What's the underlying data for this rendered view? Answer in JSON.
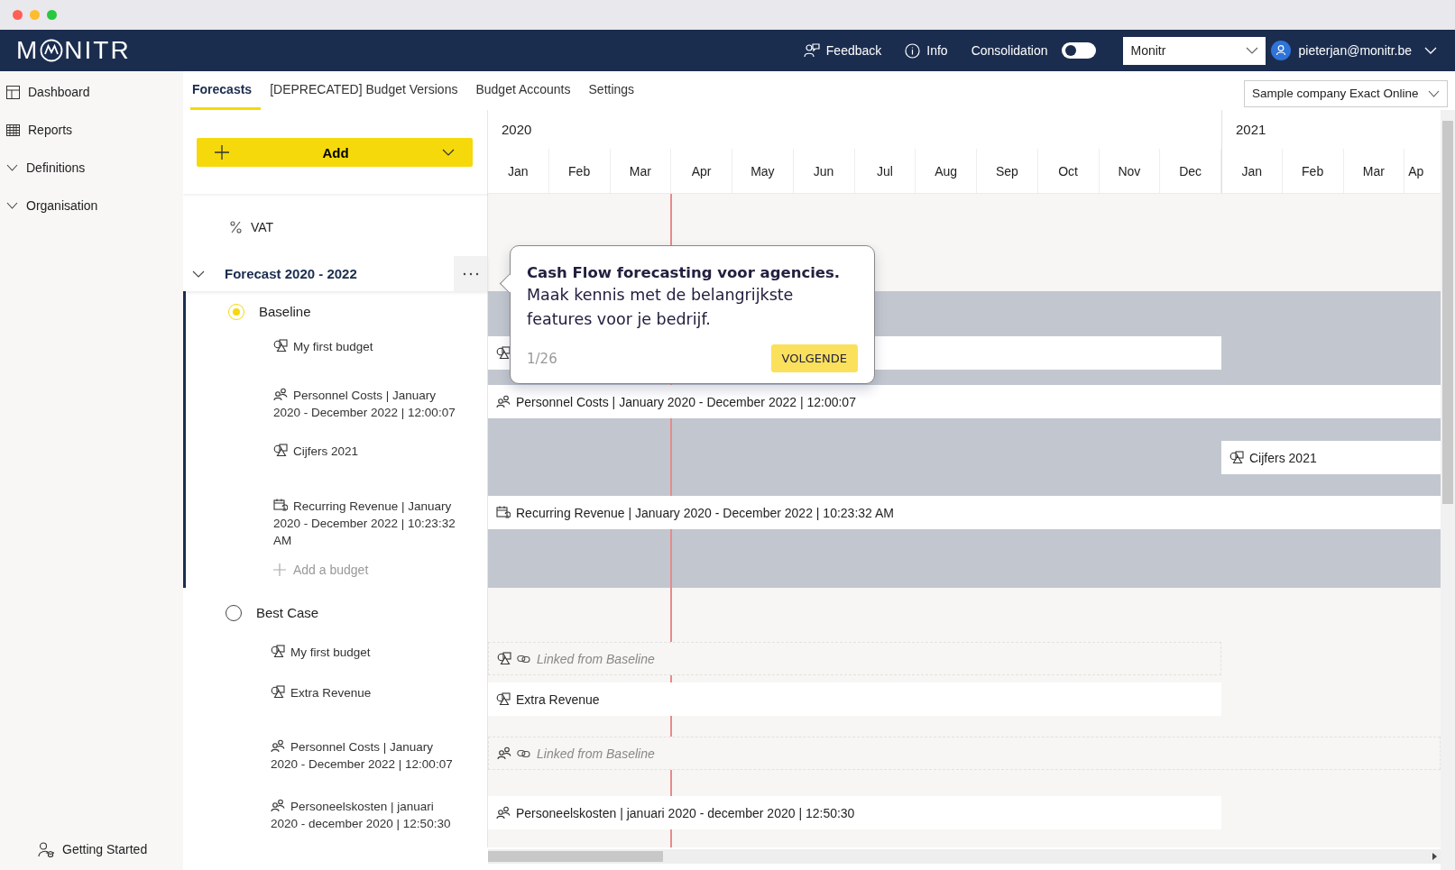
{
  "nav": {
    "logo": {
      "before": "M",
      "after": "NITR"
    },
    "feedback": "Feedback",
    "info": "Info",
    "consolidation": {
      "label": "Consolidation",
      "on": false
    },
    "workspace": "Monitr",
    "user": "pieterjan@monitr.be"
  },
  "sidebar": {
    "items": [
      {
        "label": "Dashboard",
        "kind": "grid"
      },
      {
        "label": "Reports",
        "kind": "table"
      },
      {
        "label": "Definitions",
        "kind": "group",
        "expanded": false
      },
      {
        "label": "Organisation",
        "kind": "group",
        "expanded": false
      }
    ],
    "footer": "Getting Started"
  },
  "tabs": [
    {
      "label": "Forecasts",
      "selected": true
    },
    {
      "label": "[DEPRECATED] Budget Versions",
      "selected": false
    },
    {
      "label": "Budget Accounts",
      "selected": false
    },
    {
      "label": "Settings",
      "selected": false
    }
  ],
  "company": "Sample company Exact Online",
  "add_button": "Add",
  "timeline": {
    "years": [
      {
        "label": "2020",
        "months": [
          "Jan",
          "Feb",
          "Mar",
          "Apr",
          "May",
          "Jun",
          "Jul",
          "Aug",
          "Sep",
          "Oct",
          "Nov",
          "Dec"
        ]
      },
      {
        "label": "2021",
        "months": [
          "Jan",
          "Feb",
          "Mar",
          "Ap"
        ]
      }
    ]
  },
  "tree": {
    "vat": "VAT",
    "forecast": {
      "title": "Forecast 2020 - 2022",
      "expanded": true,
      "scenarios": [
        {
          "name": "Baseline",
          "selected": true,
          "add_label": "Add a budget",
          "budgets": [
            {
              "label": "My first budget",
              "kind": "shapes",
              "bar": {
                "kind": "year"
              }
            },
            {
              "label": "Personnel Costs | January 2020 - December 2022 | 12:00:07",
              "kind": "people",
              "bar": {
                "kind": "full",
                "label": "Personnel Costs | January 2020 - December 2022 | 12:00:07"
              }
            },
            {
              "label": "Cijfers 2021",
              "kind": "shapes",
              "bar": {
                "kind": "late",
                "label": "Cijfers 2021"
              }
            },
            {
              "label": "Recurring Revenue | January 2020 - December 2022 | 10:23:32 AM",
              "kind": "calendar",
              "bar": {
                "kind": "full",
                "label": "Recurring Revenue | January 2020 - December 2022 | 10:23:32 AM"
              }
            }
          ]
        },
        {
          "name": "Best Case",
          "selected": false,
          "budgets": [
            {
              "label": "My first budget",
              "kind": "shapes",
              "bar": {
                "kind": "linked-year",
                "label": "Linked from Baseline"
              }
            },
            {
              "label": "Extra Revenue",
              "kind": "shapes",
              "bar": {
                "kind": "year",
                "label": "Extra Revenue"
              }
            },
            {
              "label": "Personnel Costs | January 2020 - December 2022 | 12:00:07",
              "kind": "people",
              "bar": {
                "kind": "linked-full",
                "label": "Linked from Baseline"
              }
            },
            {
              "label": "Personeelskosten | januari 2020 - december 2020 | 12:50:30",
              "kind": "people",
              "bar": {
                "kind": "year",
                "label": "Personeelskosten | januari 2020 - december 2020 | 12:50:30"
              }
            }
          ]
        }
      ]
    }
  },
  "tour": {
    "title": "Cash Flow forecasting voor agencies.",
    "text": "Maak kennis met de belangrijkste features voor je bedrijf.",
    "counter": "1/26",
    "next": "VOLGENDE"
  }
}
